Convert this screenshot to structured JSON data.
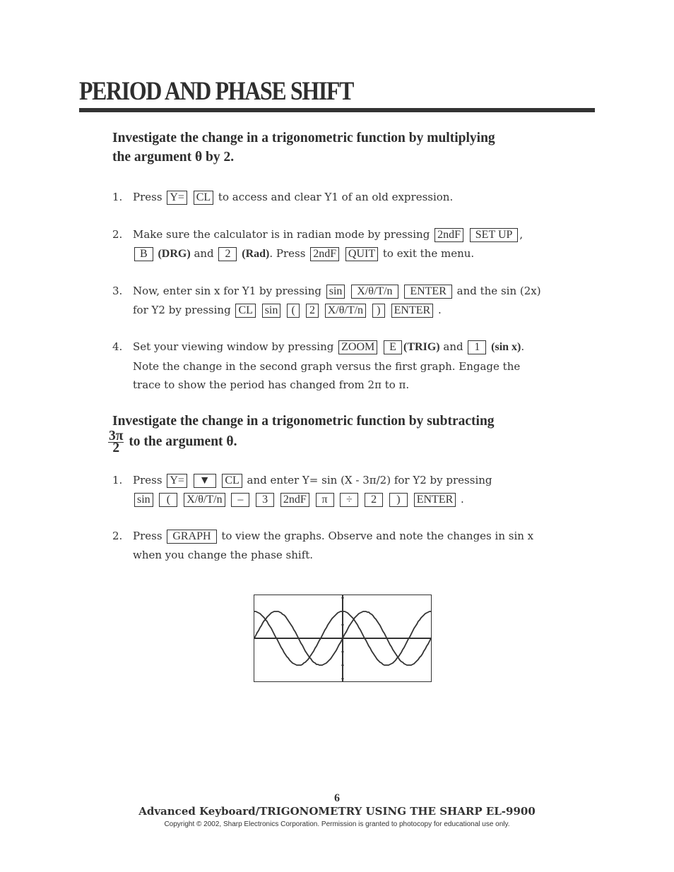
{
  "page_title": "PERIOD AND PHASE SHIFT",
  "section1": {
    "heading_line1": "Investigate the change in a trigonometric function by multiplying",
    "heading_line2": "the argument θ by 2.",
    "steps": [
      {
        "number": "1.",
        "t1": "Press",
        "k1": "Y=",
        "k2": "CL",
        "t2": "to access and clear Y1 of an old expression."
      },
      {
        "number": "2.",
        "t1": "Make sure the calculator is in radian mode by pressing",
        "k1": "2ndF",
        "k2": "SET UP",
        "t2": ",",
        "k3": "B",
        "b1": "(DRG)",
        "t3": "and",
        "k4": "2",
        "b2": "(Rad)",
        "t4": ".  Press",
        "k5": "2ndF",
        "k6": "QUIT",
        "t5": "to exit the menu."
      },
      {
        "number": "3.",
        "t1": "Now, enter sin x for Y1 by pressing",
        "k1": "sin",
        "k2": "X/θ/T/n",
        "k3": "ENTER",
        "t2": "and the sin (2x)",
        "t3": "for Y2 by pressing",
        "k4": "CL",
        "k5": "sin",
        "k6": "(",
        "k7": "2",
        "k8": "X/θ/T/n",
        "k9": ")",
        "k10": "ENTER",
        "t4": "."
      },
      {
        "number": "4.",
        "t1": "Set your viewing window by pressing",
        "k1": "ZOOM",
        "k2": "E",
        "b1": "(TRIG)",
        "t2": "and",
        "k3": "1",
        "b2": "(sin x)",
        "t3": ".",
        "line2": "Note the change in the second graph versus the first graph.  Engage the",
        "line3": "trace to show the period has changed from 2π to π."
      }
    ]
  },
  "section2": {
    "heading_line1": "Investigate the change in a trigonometric function by subtracting",
    "frac_num": "3π",
    "frac_den": "2",
    "heading_line2": "to the argument θ.",
    "steps": [
      {
        "number": "1.",
        "t1": "Press",
        "k1": "Y=",
        "k2": "▼",
        "k3": "CL",
        "t2": "and enter Y= sin (X - 3π/2) for Y2 by pressing",
        "keys2": [
          "sin",
          "(",
          "X/θ/T/n",
          "–",
          "3",
          "2ndF",
          "π",
          "÷",
          "2",
          ")",
          "ENTER"
        ],
        "t3": "."
      },
      {
        "number": "2.",
        "t1": "Press",
        "k1": "GRAPH",
        "t2": "to view the graphs.  Observe and note the changes in sin x",
        "line2": "when you change the phase shift."
      }
    ]
  },
  "calculator_screen": {
    "functions": [
      "sin(x)",
      "sin(x - 3π/2)"
    ],
    "x_range": [
      "-2π",
      "2π"
    ],
    "y_range": [
      -1.6,
      1.6
    ],
    "y_tick_step": 0.5
  },
  "footer": {
    "page_number": "6",
    "book_title": "Advanced Keyboard/TRIGONOMETRY USING THE SHARP EL-9900",
    "copyright": "Copyright © 2002, Sharp Electronics Corporation.  Permission is granted to photocopy for educational use only."
  }
}
